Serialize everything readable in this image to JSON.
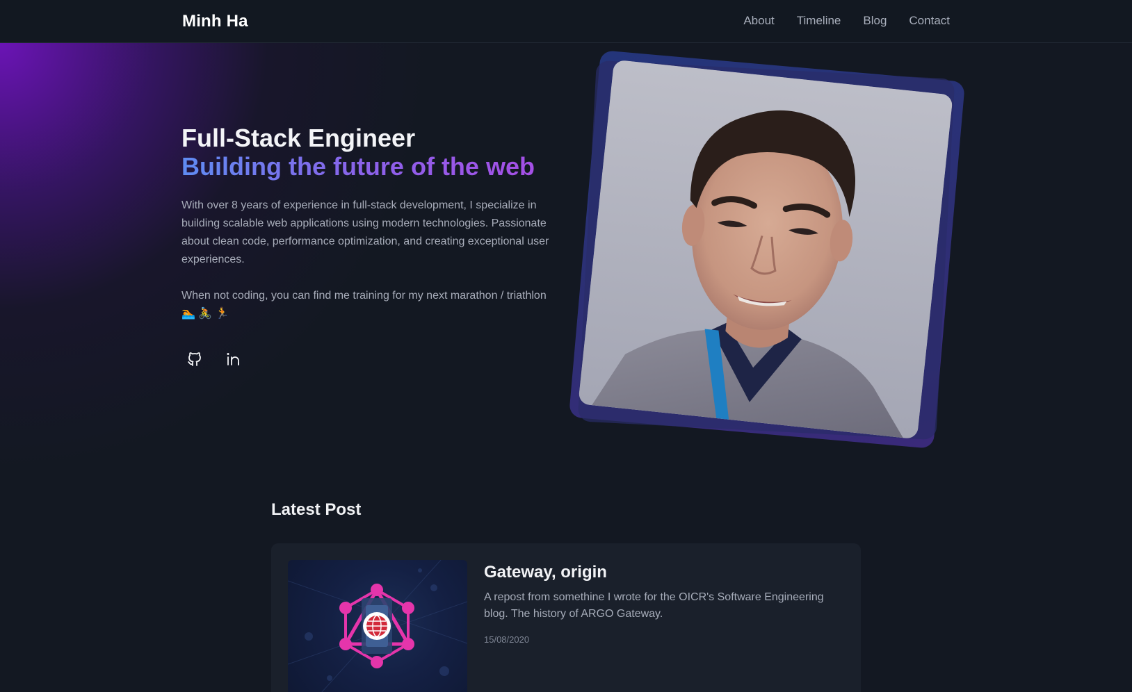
{
  "header": {
    "brand": "Minh Ha",
    "nav": [
      "About",
      "Timeline",
      "Blog",
      "Contact"
    ]
  },
  "hero": {
    "title": "Full-Stack Engineer",
    "subtitle": "Building the future of the web",
    "paragraph1": "With over 8 years of experience in full-stack development, I specialize in building scalable web applications using modern technologies. Passionate about clean code, performance optimization, and creating exceptional user experiences.",
    "paragraph2": "When not coding, you can find me training for my next marathon / triathlon 🏊 🚴 🏃",
    "socials": [
      {
        "icon": "github-icon"
      },
      {
        "icon": "linkedin-icon"
      }
    ],
    "photo_icon": "profile-photo"
  },
  "latest_post": {
    "section_title": "Latest Post",
    "title": "Gateway, origin",
    "description": "A repost from somethine I wrote for the OICR's Software Engineering blog. The history of ARGO Gateway.",
    "date": "15/08/2020",
    "thumbnail_icon": "graphql-gateway-icon"
  },
  "colors": {
    "background": "#131822",
    "header": "#121821",
    "accent_gradient_start": "#5f8cf2",
    "accent_gradient_end": "#a54fe6",
    "glow": "#7014be",
    "card": "#1a202b",
    "graphql_pink": "#e535ab"
  }
}
